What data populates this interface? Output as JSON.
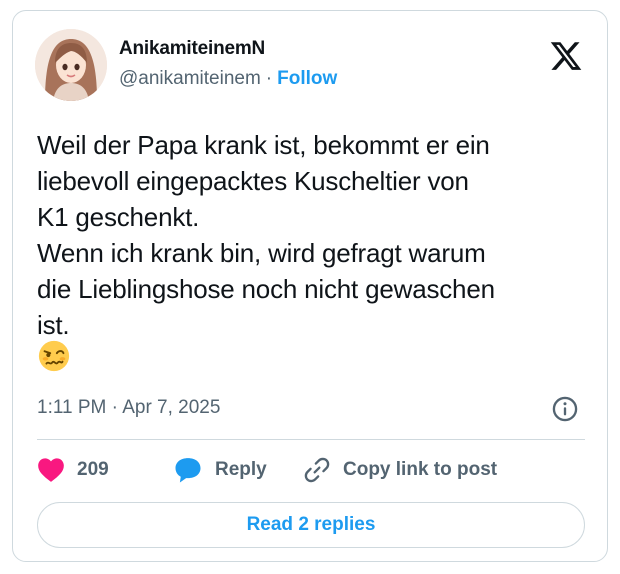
{
  "author": {
    "display_name": "AnikamiteinemN",
    "handle": "@anikamiteinem",
    "separator": "·",
    "follow_label": "Follow",
    "avatar_icon": "avatar-illustration-icon"
  },
  "brand": {
    "logo_icon": "x-logo-icon"
  },
  "post": {
    "lines": [
      "Weil der Papa krank ist, bekommt er ein",
      "liebevoll eingepacktes Kuscheltier von",
      "K1 geschenkt.",
      "Wenn ich krank bin, wird gefragt warum",
      "die Lieblingshose noch nicht gewaschen",
      "ist."
    ],
    "emoji": "🥴",
    "time": "1:11 PM",
    "separator": "·",
    "date": "Apr 7, 2025"
  },
  "actions": {
    "like_count": "209",
    "reply_label": "Reply",
    "copy_label": "Copy link to post",
    "read_replies_label": "Read 2 replies"
  },
  "colors": {
    "accent": "#1d9bf0",
    "like": "#f91880",
    "text": "#0f1419",
    "muted": "#536471",
    "border": "#cfd9de"
  }
}
